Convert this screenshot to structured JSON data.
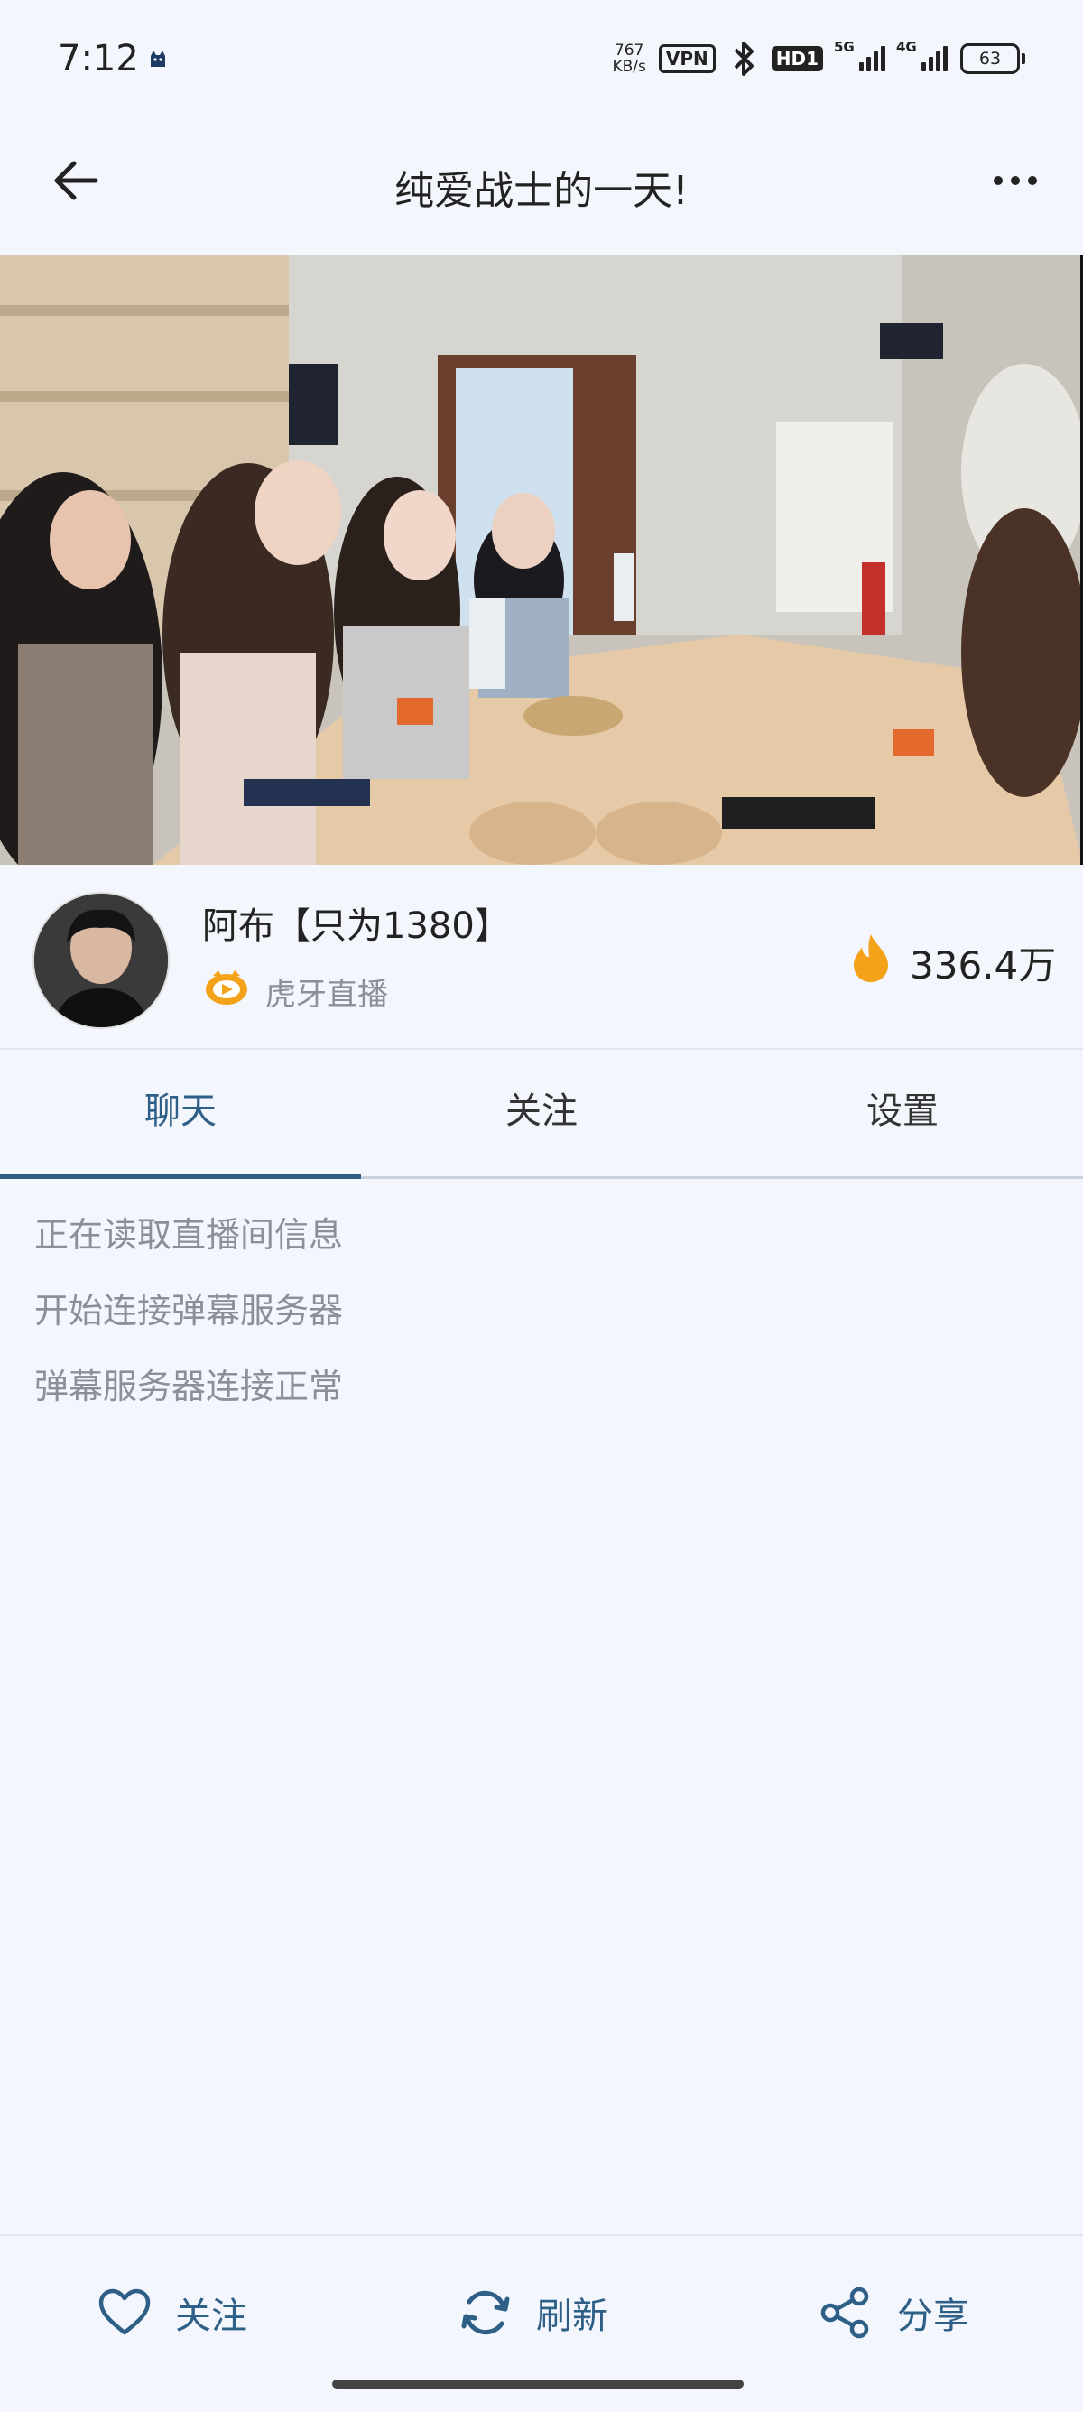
{
  "status_bar": {
    "time": "7:12",
    "speed_value": "767",
    "speed_unit": "KB/s",
    "vpn": "VPN",
    "hd": "HD1",
    "net1": "5G",
    "net2": "4G",
    "battery": "63"
  },
  "header": {
    "title": "纯爱战士的一天!"
  },
  "streamer": {
    "name": "阿布【只为1380】",
    "platform": "虎牙直播",
    "heat": "336.4万"
  },
  "tabs": [
    {
      "label": "聊天"
    },
    {
      "label": "关注"
    },
    {
      "label": "设置"
    }
  ],
  "chat": {
    "messages": [
      "正在读取直播间信息",
      "开始连接弹幕服务器",
      "弹幕服务器连接正常"
    ]
  },
  "bottom_bar": {
    "follow": "关注",
    "refresh": "刷新",
    "share": "分享"
  },
  "colors": {
    "accent": "#2e5f86",
    "background": "#f3f6fc",
    "fire": "#f5a21b"
  }
}
